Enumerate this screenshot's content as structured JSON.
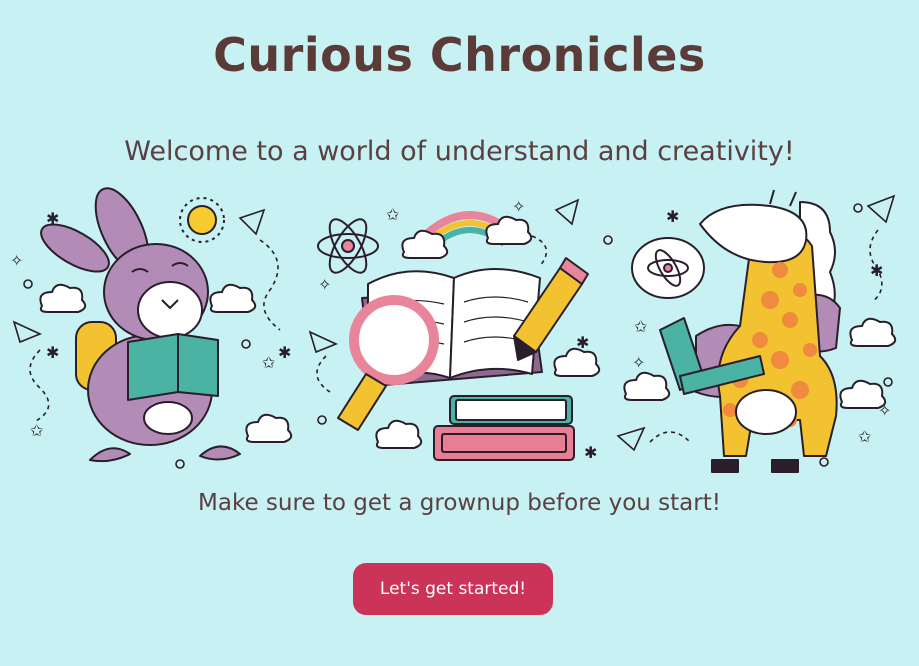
{
  "header": {
    "title": "Curious Chronicles"
  },
  "hero": {
    "welcome": "Welcome to a world of understand and creativity!",
    "grownup_note": "Make sure to get a grownup before you start!"
  },
  "cta": {
    "label": "Let's get started!"
  },
  "colors": {
    "background": "#c8f1f3",
    "accent": "#cb3358",
    "title": "#5a3b37"
  },
  "illustrations": [
    "bunny-reading-icon",
    "open-book-icon",
    "giraffe-reading-icon"
  ]
}
